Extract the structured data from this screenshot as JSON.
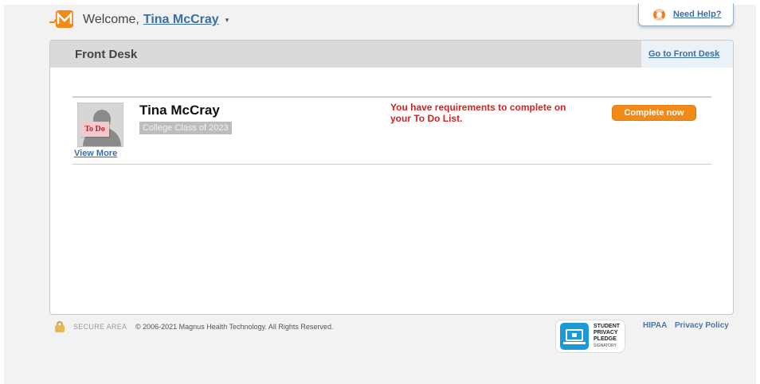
{
  "header": {
    "welcome_text": "Welcome,",
    "user_name": "Tina McCray",
    "caret": "▾"
  },
  "help": {
    "label": "Need Help?"
  },
  "panel": {
    "title": "Front Desk",
    "front_desk_link": "Go to Front Desk"
  },
  "student": {
    "name": "Tina McCray",
    "class": "College Class of 2023",
    "todo_tag": "To Do",
    "view_more": "View More",
    "requirement_message": "You have requirements to complete on your To Do List.",
    "action_label": "Complete now"
  },
  "footer": {
    "secure_label": "SECURE AREA",
    "copyright": "© 2006-2021 Magnus Health Technology. All Rights Reserved.",
    "pledge_lines": [
      "STUDENT",
      "PRIVACY",
      "PLEDGE"
    ],
    "pledge_signatory": "SIGNATORY",
    "hipaa_link": "HIPAA",
    "privacy_link": "Privacy Policy"
  },
  "colors": {
    "accent_link": "#3a6ea5",
    "button_orange": "#f28a1a",
    "alert_red": "#d32222",
    "header_gray": "#dadada"
  }
}
